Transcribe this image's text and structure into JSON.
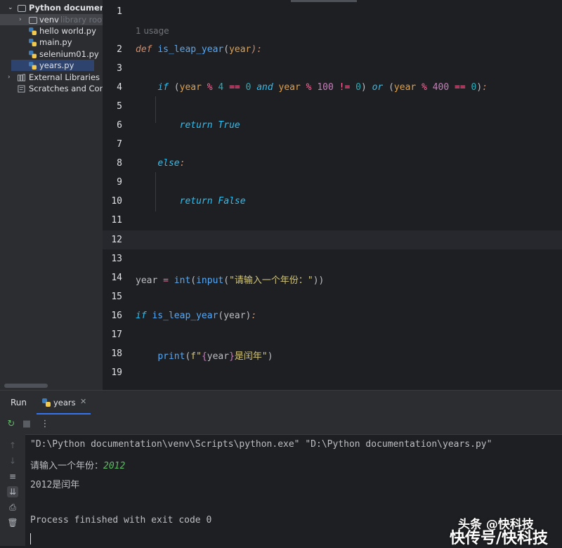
{
  "project_tree": {
    "root_label": "Python documentation",
    "items": [
      {
        "label": "venv",
        "suffix": "library root"
      },
      {
        "label": "hello world.py"
      },
      {
        "label": "main.py"
      },
      {
        "label": "selenium01.py"
      },
      {
        "label": "years.py"
      },
      {
        "label": "External Libraries"
      },
      {
        "label": "Scratches and Consoles"
      }
    ]
  },
  "editor": {
    "usage_hint": "1 usage",
    "line_numbers": [
      "1",
      "2",
      "3",
      "4",
      "5",
      "6",
      "7",
      "8",
      "9",
      "10",
      "11",
      "12",
      "13",
      "14",
      "15",
      "16",
      "17",
      "18",
      "19"
    ],
    "code": {
      "l2_def": "def",
      "l2_fn": "is_leap_year",
      "l2_param": "year",
      "l4_if": "if",
      "l4_and": "and",
      "l4_or": "or",
      "l6_return": "return",
      "l6_true": "True",
      "l8_else": "else",
      "l10_return": "return",
      "l10_false": "False",
      "l14_var": "year",
      "l14_int": "int",
      "l14_input": "input",
      "l14_str": "\"请输入一个年份：\"",
      "l16_if": "if",
      "l16_call": "is_leap_year",
      "l18_print": "print",
      "l18_fstr_prefix": "f\"",
      "l18_var": "year",
      "l18_fstr_rest": "是闰年\""
    }
  },
  "run_panel": {
    "title": "Run",
    "tab_label": "years",
    "console_lines": [
      "\"D:\\Python documentation\\venv\\Scripts\\python.exe\" \"D:\\Python documentation\\years.py\"",
      "请输入一个年份：",
      "2012是闰年",
      "",
      "Process finished with exit code 0"
    ],
    "user_input": "2012"
  },
  "watermark": {
    "line1": "头条 @快科技",
    "line2": "快传号/快科技"
  },
  "colors": {
    "keyword": "#cf8e6d",
    "function": "#56a8f5",
    "parameter": "#e0a14a",
    "number": "#2aacb8",
    "string": "#d4c77a",
    "console_input": "#5fb865"
  }
}
